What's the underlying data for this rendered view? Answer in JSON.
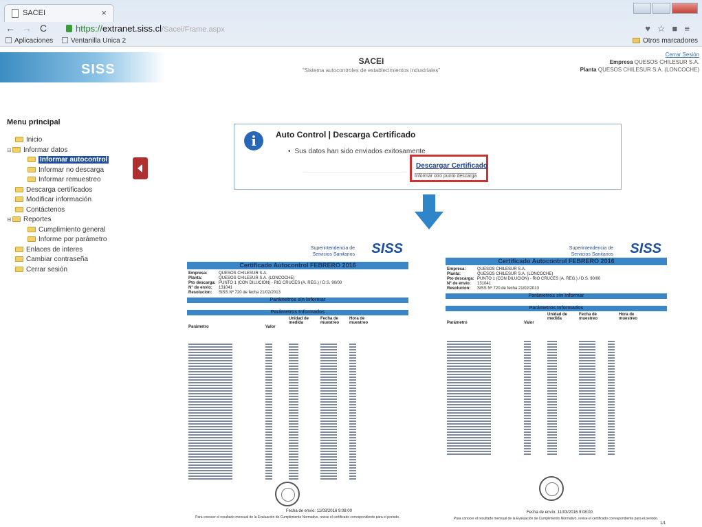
{
  "browser": {
    "tab_title": "SACEI",
    "tab_close": "×",
    "url_scheme": "https://",
    "url_host": "extranet.siss.cl",
    "url_path": "/Sacei/Frame.aspx",
    "bookmarks": [
      "Aplicaciones",
      "Ventanilla Unica 2"
    ],
    "other_bookmarks": "Otros marcadores"
  },
  "header": {
    "logo": "SISS",
    "title": "SACEI",
    "subtitle": "\"Sistema autocontroles de establecimientos industriales\"",
    "logout": "Cerrar Sesión",
    "empresa_label": "Empresa",
    "empresa_value": "QUESOS CHILESUR S.A.",
    "planta_label": "Planta",
    "planta_value": "QUESOS CHILESUR S.A. (LONCOCHE)"
  },
  "menu": {
    "title": "Menu principal",
    "items": [
      {
        "label": "Inicio"
      },
      {
        "label": "Informar datos"
      },
      {
        "label": "Informar autocontrol"
      },
      {
        "label": "Informar no descarga"
      },
      {
        "label": "Informar remuestreo"
      },
      {
        "label": "Descarga certificados"
      },
      {
        "label": "Modificar información"
      },
      {
        "label": "Contáctenos"
      },
      {
        "label": "Reportes"
      },
      {
        "label": "Cumplimiento general"
      },
      {
        "label": "Informe por parámetro"
      },
      {
        "label": "Enlaces de interes"
      },
      {
        "label": "Cambiar contraseña"
      },
      {
        "label": "Cerrar sesión"
      }
    ]
  },
  "panel": {
    "icon": "i",
    "title": "Auto Control | Descarga Certificado",
    "message": "Sus datos han sido enviados exitosamente",
    "download_link": "Descargar Certificado",
    "download_sub": "Informar otro punto descarga"
  },
  "certificates": [
    {
      "org": "Superintendencia de Servicios Sanitarios",
      "logo": "SISS",
      "title": "Certificado Autocontrol FEBRERO 2016",
      "meta": [
        {
          "k": "Empresa:",
          "v": "QUESOS CHILESUR S.A."
        },
        {
          "k": "Planta:",
          "v": "QUESOS CHILESUR S.A. (LONCOCHE)"
        },
        {
          "k": "Pto descarga:",
          "v": "PUNTO 1 (CON DILUCION) - RIO CRUCES (A. REG.) / D.S. 90/00"
        },
        {
          "k": "N° de envio:",
          "v": "131041"
        },
        {
          "k": "Resolucion:",
          "v": "SISS Nº 720 de fecha 21/02/2013"
        }
      ],
      "bar_no": "Parámetros sin informar",
      "bar_yes": "Parámetros Informados",
      "cols": [
        "Parámetro",
        "Valor",
        "Unidad de medida",
        "Fecha de muestreo",
        "Hora de muestreo"
      ],
      "date": "Fecha de envío: 11/03/2016 9:08:00",
      "foot": "Para conocer el resultado mensual de la Evaluación de Cumplimiento Normativo, revise el certificado correspondiente para el periodo."
    },
    {
      "org": "Superintendencia de Servicios Sanitarios",
      "logo": "SISS",
      "title": "Certificado Autocontrol FEBRERO 2016",
      "meta": [
        {
          "k": "Empresa:",
          "v": "QUESOS CHILESUR S.A."
        },
        {
          "k": "Planta:",
          "v": "QUESOS CHILESUR S.A. (LONCOCHE)"
        },
        {
          "k": "Pto descarga:",
          "v": "PUNTO 1 (CON DILUCION) - RIO CRUCES (A. REG.) / D.S. 90/00"
        },
        {
          "k": "N° de envio:",
          "v": "131041"
        },
        {
          "k": "Resolucion:",
          "v": "SISS Nº 720 de fecha 21/02/2013"
        }
      ],
      "bar_no": "Parámetros sin informar",
      "bar_yes": "Parámetros Informados",
      "cols": [
        "Parámetro",
        "Valor",
        "Unidad de medida",
        "Fecha de muestreo",
        "Hora de muestreo"
      ],
      "date": "Fecha de envío: 11/03/2016 9:08:00",
      "foot": "Para conocer el resultado mensual de la Evaluación de Cumplimiento Normativo, revise el certificado correspondiente para el periodo.",
      "page": "1/1"
    }
  ]
}
